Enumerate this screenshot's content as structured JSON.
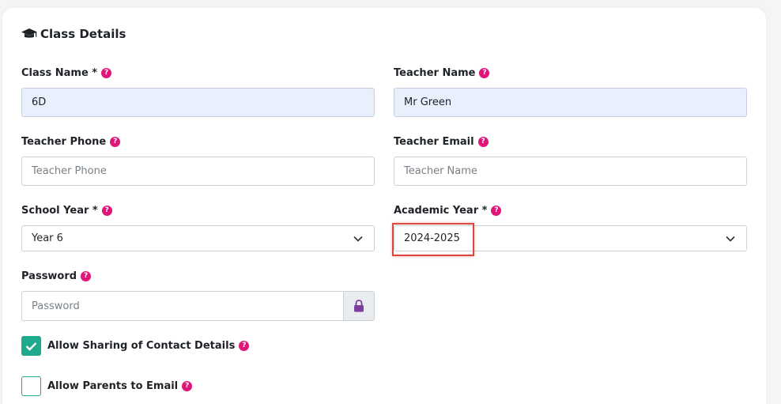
{
  "section": {
    "title": "Class Details",
    "icon": "graduation-cap-icon"
  },
  "help_glyph": "?",
  "fields": {
    "class_name": {
      "label": "Class Name *",
      "value": "6D"
    },
    "teacher_name": {
      "label": "Teacher Name",
      "value": "Mr Green"
    },
    "teacher_phone": {
      "label": "Teacher Phone",
      "placeholder": "Teacher Phone"
    },
    "teacher_email": {
      "label": "Teacher Email",
      "placeholder": "Teacher Name"
    },
    "school_year": {
      "label": "School Year *",
      "value": "Year 6"
    },
    "academic_year": {
      "label": "Academic Year *",
      "value": "2024-2025"
    },
    "password": {
      "label": "Password",
      "placeholder": "Password",
      "addon_icon": "lock-icon"
    }
  },
  "checkboxes": {
    "allow_sharing": {
      "label": "Allow Sharing of Contact Details",
      "checked": true
    },
    "allow_parents_email": {
      "label": "Allow Parents to Email",
      "checked": false
    }
  },
  "colors": {
    "help_badge": "#e0157a",
    "checkbox_accent": "#1fa98d",
    "filled_input_bg": "#e8effd",
    "highlight_border": "#e0463c",
    "lock_icon": "#7b3fa0"
  }
}
